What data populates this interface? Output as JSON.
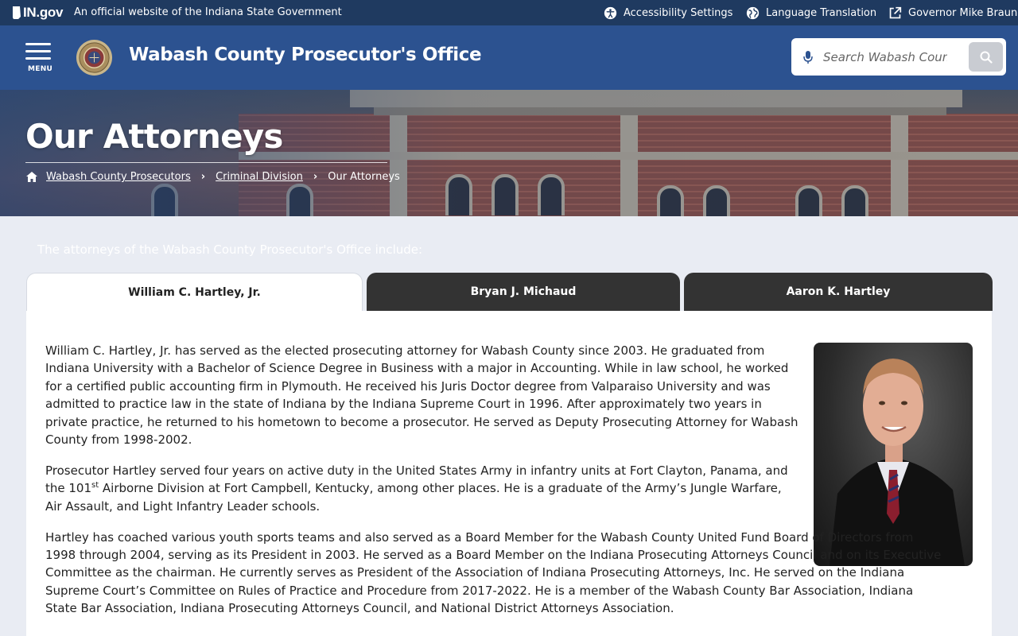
{
  "topbar": {
    "logo_text": "IN.gov",
    "official_text": "An official website of the Indiana State Government",
    "links": [
      {
        "label": "Accessibility Settings",
        "icon": "accessibility-icon"
      },
      {
        "label": "Language Translation",
        "icon": "globe-icon"
      },
      {
        "label": "Governor Mike Braun",
        "icon": "external-link-icon"
      }
    ]
  },
  "header": {
    "menu_label": "MENU",
    "site_title": "Wabash County Prosecutor's Office",
    "search_placeholder": "Search Wabash County"
  },
  "hero": {
    "page_title": "Our Attorneys",
    "breadcrumb": [
      "Wabash County Prosecutors",
      "Criminal Division",
      "Our Attorneys"
    ]
  },
  "main": {
    "intro": "The attorneys of the Wabash County Prosecutor's Office include:",
    "tabs": [
      "William C. Hartley, Jr.",
      "Bryan J. Michaud",
      "Aaron K. Hartley"
    ],
    "bio": {
      "p1": "William C. Hartley, Jr. has served as the elected prosecuting attorney for Wabash County since 2003. He graduated from Indiana University with a Bachelor of Science Degree in Business with a major in Accounting. While in law school, he worked for a certified public accounting firm in Plymouth. He received his Juris Doctor degree from Valparaiso University and was admitted to practice law in the state of Indiana by the Indiana Supreme Court in 1996. After approximately two years in private practice, he returned to his hometown to become a prosecutor. He served as Deputy Prosecuting Attorney for Wabash County from 1998-2002.",
      "p2_a": "Prosecutor Hartley served four years on active duty in the United States Army in infantry units at Fort Clayton, Panama, and the 101",
      "p2_sup": "st",
      "p2_b": " Airborne Division at Fort Campbell, Kentucky, among other places. He is a graduate of the Army’s Jungle Warfare, Air Assault, and Light Infantry Leader schools.",
      "p3": "Hartley has coached various youth sports teams and also served as a Board Member for the Wabash County United Fund Board of Directors from 1998 through 2004, serving as its President in 2003.  He served as a Board Member on the Indiana Prosecuting Attorneys Council and on its Executive Committee as the chairman. He currently serves as President of the Association of Indiana Prosecuting Attorneys, Inc. He served on the Indiana Supreme Court’s Committee on Rules of Practice and Procedure from 2017-2022. He is a member of the Wabash County Bar Association, Indiana State Bar Association, Indiana Prosecuting Attorneys Council, and National District Attorneys Association."
    }
  },
  "colors": {
    "topbar_bg": "#1f3a60",
    "header_bg": "#2c5290",
    "tab_inactive_bg": "#333333",
    "page_bg": "#e9ecf3"
  }
}
